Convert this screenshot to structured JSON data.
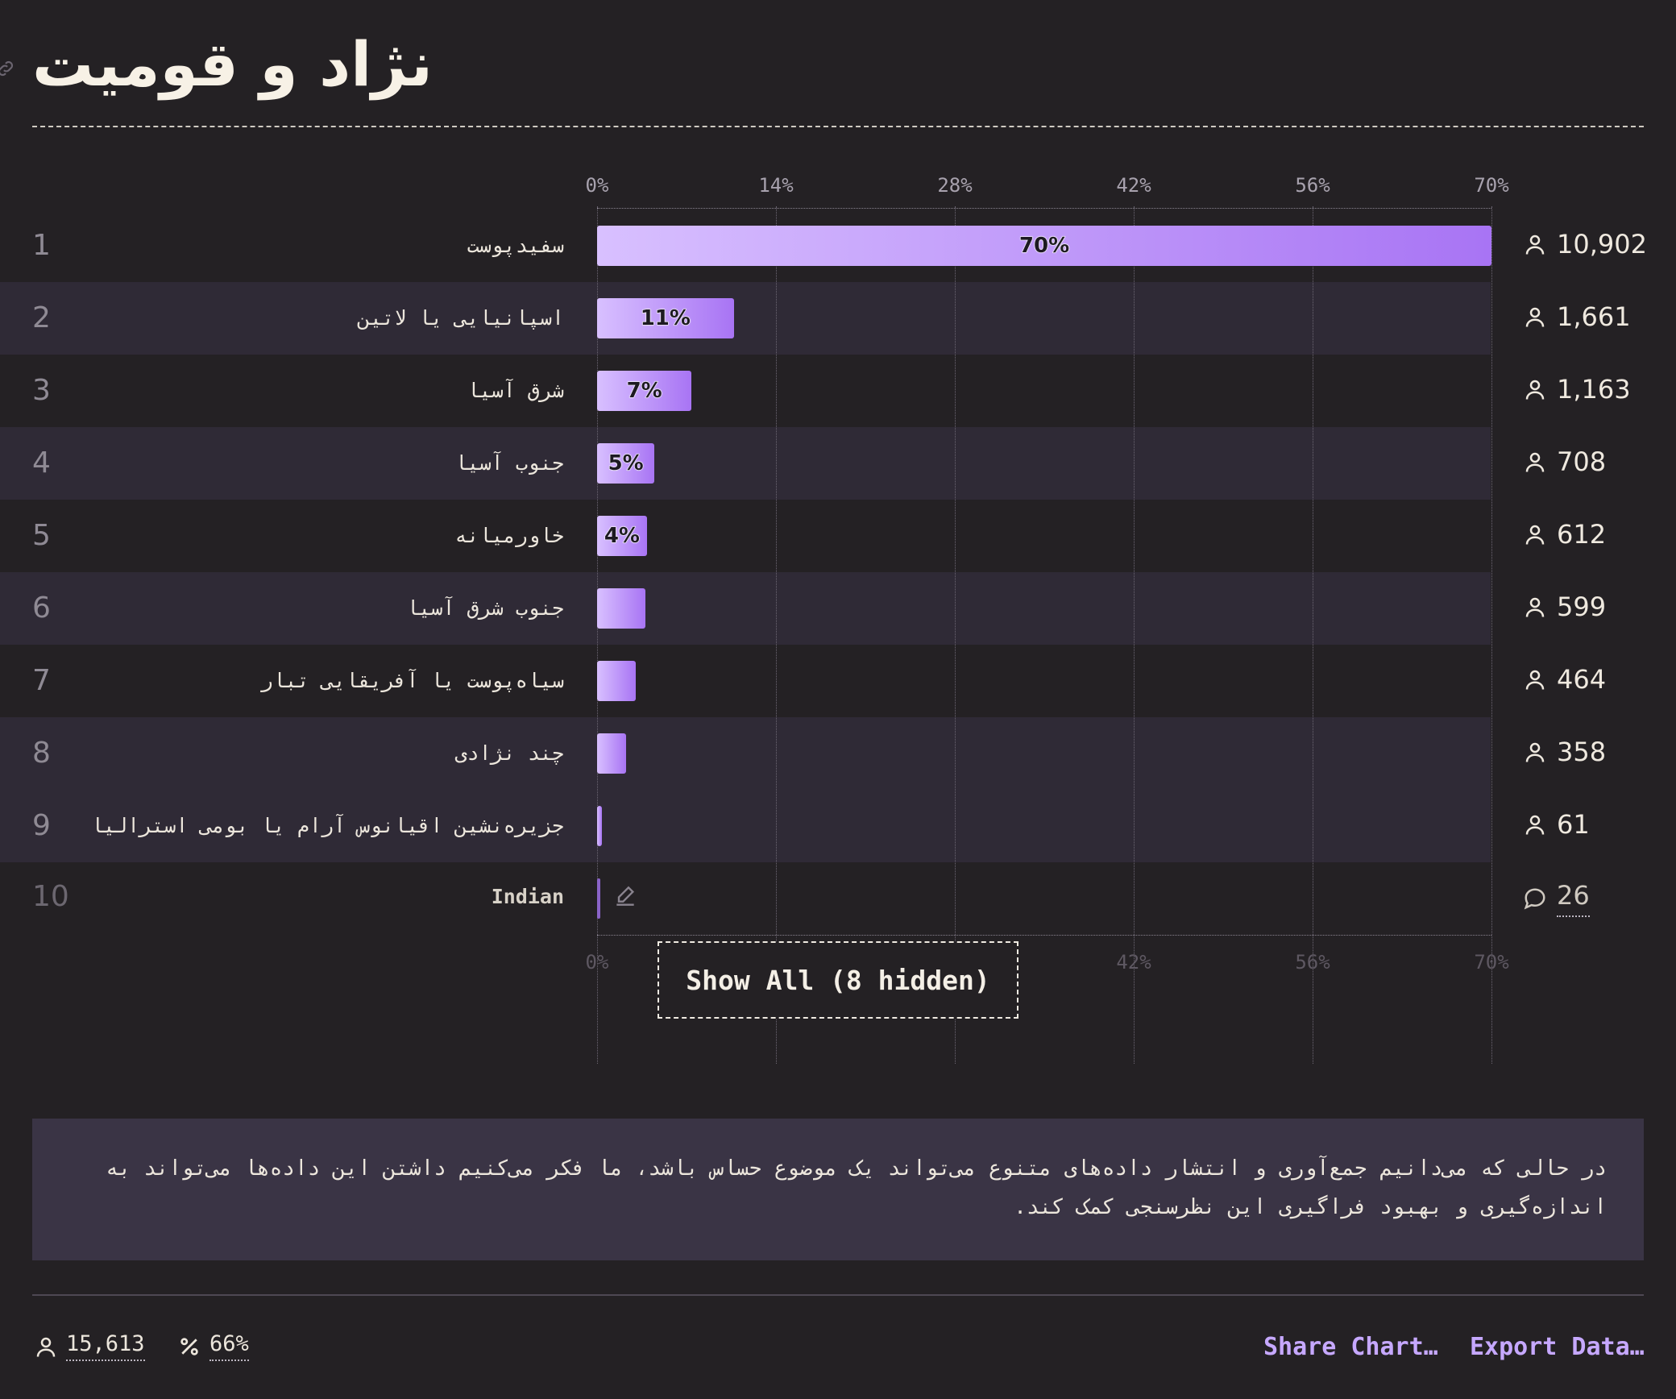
{
  "header": {
    "title": "نژاد و قومیت"
  },
  "axis_ticks": [
    "0%",
    "14%",
    "28%",
    "42%",
    "56%",
    "70%"
  ],
  "rows": [
    {
      "rank": "1",
      "label": "سفیدپوست",
      "percent_label": "70%",
      "count": "10,902"
    },
    {
      "rank": "2",
      "label": "اسپانیایی یا لاتین",
      "percent_label": "11%",
      "count": "1,661"
    },
    {
      "rank": "3",
      "label": "شرق آسیا",
      "percent_label": "7%",
      "count": "1,163"
    },
    {
      "rank": "4",
      "label": "جنوب آسیا",
      "percent_label": "5%",
      "count": "708"
    },
    {
      "rank": "5",
      "label": "خاورمیانه",
      "percent_label": "4%",
      "count": "612"
    },
    {
      "rank": "6",
      "label": "جنوب شرق آسیا",
      "percent_label": "",
      "count": "599"
    },
    {
      "rank": "7",
      "label": "سیاه‌پوست یا آفریقایی تبار",
      "percent_label": "",
      "count": "464"
    },
    {
      "rank": "8",
      "label": "چند نژادی",
      "percent_label": "",
      "count": "358"
    },
    {
      "rank": "9",
      "label": "جزیره‌نشین اقیانوس آرام یا بومی استرالیا",
      "percent_label": "",
      "count": "61"
    },
    {
      "rank": "10",
      "label": "Indian",
      "percent_label": "",
      "count": "26"
    }
  ],
  "chart_data": {
    "type": "bar",
    "orientation": "horizontal",
    "categories": [
      "سفیدپوست",
      "اسپانیایی یا لاتین",
      "شرق آسیا",
      "جنوب آسیا",
      "خاورمیانه",
      "جنوب شرق آسیا",
      "سیاه‌پوست یا آفریقایی تبار",
      "چند نژادی",
      "جزیره‌نشین اقیانوس آرام یا بومی استرالیا",
      "Indian"
    ],
    "values": [
      70,
      10.7,
      7.4,
      4.5,
      3.9,
      3.8,
      3.0,
      2.3,
      0.4,
      0.2
    ],
    "counts": [
      10902,
      1661,
      1163,
      708,
      612,
      599,
      464,
      358,
      61,
      26
    ],
    "unit": "%",
    "xlim": [
      0,
      70
    ],
    "ticks": [
      0,
      14,
      28,
      42,
      56,
      70
    ],
    "grid": true
  },
  "show_all_label": "Show All (8 hidden)",
  "note": "در حالی که می‌دانیم جمع‌آوری و انتشار داده‌های متنوع می‌تواند یک موضوع حساس باشد، ما فکر می‌کنیم داشتن این داده‌ها می‌تواند به اندازه‌گیری و بهبود فراگیری این نظرسنجی کمک کند.",
  "footer": {
    "respondents": "15,613",
    "percent": "66%",
    "share_label": "Share Chart…",
    "export_label": "Export Data…"
  },
  "colors": {
    "background": "#242124",
    "bar_start": "#d8c0ff",
    "bar_end": "#a874f4",
    "accent": "#c6a8ff",
    "band": "#2f2a36"
  }
}
